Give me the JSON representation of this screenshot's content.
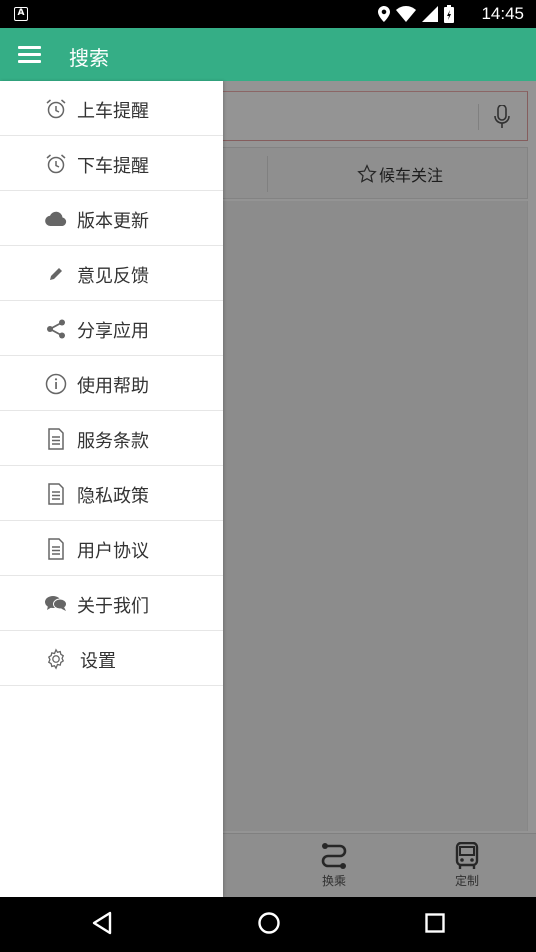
{
  "status_bar": {
    "time": "14:45",
    "notification_label": "A"
  },
  "app_bar": {
    "title": "搜索"
  },
  "main": {
    "follow_tab": "候车关注",
    "bottom_nav": [
      {
        "label": "换乘",
        "icon": "transfer-icon"
      },
      {
        "label": "定制",
        "icon": "bus-icon"
      }
    ]
  },
  "drawer": {
    "items": [
      {
        "label": "上车提醒",
        "icon": "alarm-clock-icon"
      },
      {
        "label": "下车提醒",
        "icon": "alarm-clock-icon"
      },
      {
        "label": "版本更新",
        "icon": "cloud-icon"
      },
      {
        "label": "意见反馈",
        "icon": "pencil-icon"
      },
      {
        "label": "分享应用",
        "icon": "share-icon"
      },
      {
        "label": "使用帮助",
        "icon": "info-icon"
      },
      {
        "label": "服务条款",
        "icon": "document-icon"
      },
      {
        "label": "隐私政策",
        "icon": "document-icon"
      },
      {
        "label": "用户协议",
        "icon": "document-icon"
      },
      {
        "label": "关于我们",
        "icon": "chat-icon"
      },
      {
        "label": "设置",
        "icon": "gear-icon"
      }
    ]
  },
  "colors": {
    "primary": "#35ae86",
    "drawer_text": "#333333",
    "icon": "#666666"
  }
}
